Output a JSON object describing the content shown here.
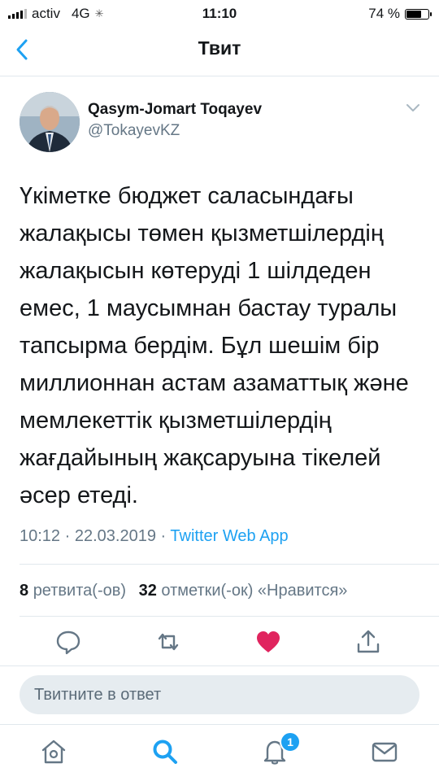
{
  "status_bar": {
    "carrier": "activ",
    "network": "4G",
    "time": "11:10",
    "battery_percent": "74 %",
    "battery_level": 0.74
  },
  "nav": {
    "title": "Твит",
    "back_icon": "chevron-left-icon"
  },
  "tweet": {
    "author_name": "Qasym-Jomart Toqayev",
    "author_handle": "@TokayevKZ",
    "text_lines": [
      "Үкіметке бюджет саласындағы",
      "жалақысы төмен қызметшілердің",
      "жалақысын көтеруді 1 шілдеден",
      "емес, 1 маусымнан бастау туралы",
      "тапсырма бердім. Бұл шешім бір",
      "миллионнан астам азаматтық және",
      "мемлекеттік қызметшілердің",
      "жағдайының жақсаруына тікелей",
      "әсер етеді."
    ],
    "time": "10:12",
    "date": "22.03.2019",
    "separator": "·",
    "source_app": "Twitter Web App",
    "retweet_count": "8",
    "retweet_label": "ретвита(-ов)",
    "like_count": "32",
    "like_label": "отметки(-ок) «Нравится»"
  },
  "reply_box": {
    "placeholder": "Твитните в ответ"
  },
  "bottom_tabs": {
    "notifications_badge": "1",
    "icons": [
      "home-icon",
      "search-icon",
      "bell-icon",
      "mail-icon"
    ]
  },
  "colors": {
    "accent": "#1da1f2",
    "like": "#e0245e",
    "secondary_text": "#657786"
  }
}
